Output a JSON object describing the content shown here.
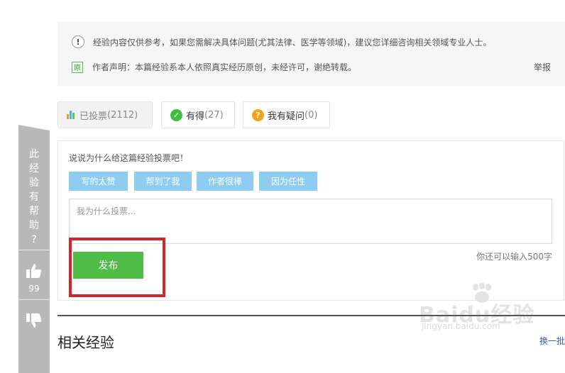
{
  "notice": {
    "disclaimer": "经验内容仅供参考，如果您需解决具体问题(尤其法律、医学等领域)，建议您详细咨询相关领域专业人士。",
    "statement": "作者声明：本篇经验系本人依照真实经历原创，未经许可，谢绝转载。",
    "original_badge": "原",
    "report_label": "举报"
  },
  "vote_tabs": {
    "voted_label": "已投票",
    "voted_count": "(2112)",
    "useful_label": "有得",
    "useful_count": "(27)",
    "question_label": "我有疑问",
    "question_count": "(0)"
  },
  "vote_panel": {
    "prompt": "说说为什么给这篇经验投票吧！",
    "reasons": [
      "写的太赞",
      "帮到了我",
      "作者很棒",
      "因为任性"
    ],
    "textarea_placeholder": "我为什么投票...",
    "char_remaining": "你还可以输入500字",
    "publish_label": "发布"
  },
  "side_ribbon": {
    "question_chars": [
      "此",
      "经",
      "验",
      "有",
      "帮",
      "助",
      "?"
    ],
    "thumbs_up_count": "99"
  },
  "related": {
    "title": "相关经验",
    "refresh_label": "换一批"
  },
  "watermark": {
    "brand": "Baidu经验",
    "url": "jingyan.baidu.com"
  },
  "colors": {
    "accent_green": "#4fbc45",
    "reason_blue": "#8ecdf2",
    "highlight_red": "#d3232b",
    "ribbon_gray": "#b8b8b8"
  }
}
